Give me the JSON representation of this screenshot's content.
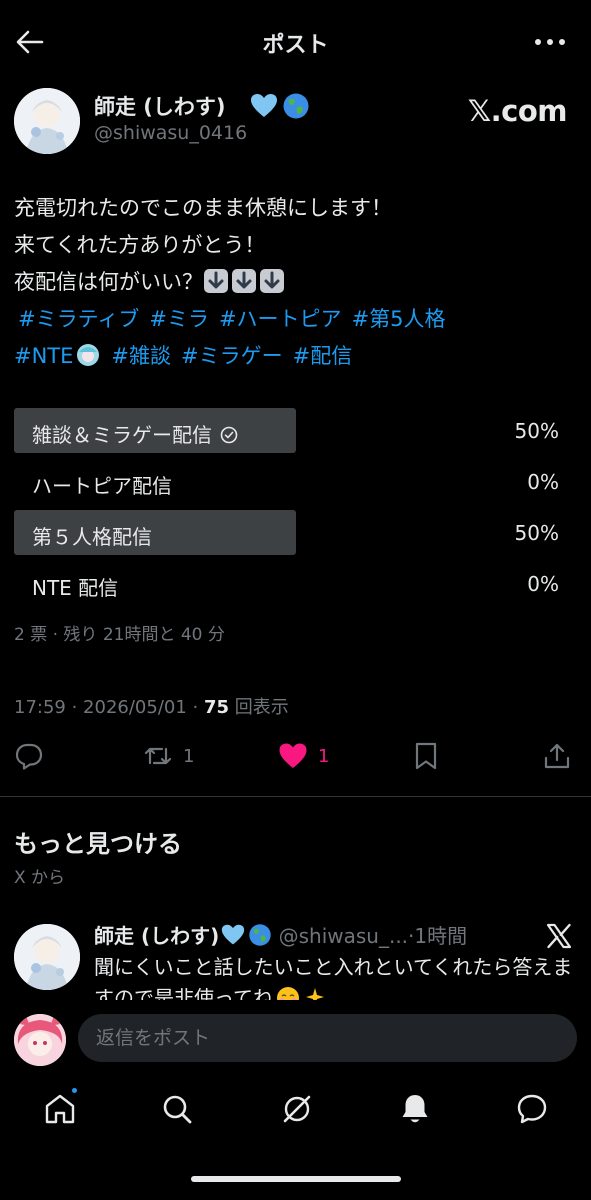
{
  "header": {
    "title": "ポスト"
  },
  "post": {
    "author_name": "師走 (しわす)",
    "author_handle": "@shiwasu_0416",
    "watermark": "𝕏.com",
    "text_lines": [
      "充電切れたのでこのまま休憩にします！",
      "来てくれた方ありがとう！",
      "夜配信は何がいい？"
    ],
    "hashtags_line1": [
      "#ミラティブ",
      "#ミラ",
      "#ハートピア",
      "#第5人格"
    ],
    "hashtags_line2_a": "#NTE",
    "hashtags_line2_b": [
      "#雑談",
      "#ミラゲー",
      "#配信"
    ],
    "timestamp": "17:59 · 2026/05/01 · ",
    "views_count": "75",
    "views_label": " 回表示"
  },
  "poll": {
    "options": [
      {
        "label": "雑談＆ミラゲー配信",
        "percent": "50%",
        "fraction": 0.5,
        "selected": true
      },
      {
        "label": "ハートピア配信",
        "percent": "0%",
        "fraction": 0,
        "selected": false
      },
      {
        "label": "第５人格配信",
        "percent": "50%",
        "fraction": 0.5,
        "selected": false
      },
      {
        "label": "NTE 配信",
        "percent": "0%",
        "fraction": 0,
        "selected": false
      }
    ],
    "meta": "2 票 · 残り 21時間と 40 分"
  },
  "actions": {
    "reposts": "1",
    "likes": "1"
  },
  "discover": {
    "title": "もっと見つける",
    "subtitle": "X から"
  },
  "related": {
    "author_name": "師走 (しわす)",
    "author_handle": " @shiwasu_...",
    "time": "·1時間",
    "text": "聞にくいこと話したいこと入れといてくれたら答えますので是非使ってね"
  },
  "reply": {
    "placeholder": "返信をポスト"
  },
  "colors": {
    "background": "#000000",
    "accent": "#1d9bf0",
    "like": "#f91880",
    "poll_bar": "#3e4144",
    "muted": "#71767b"
  }
}
